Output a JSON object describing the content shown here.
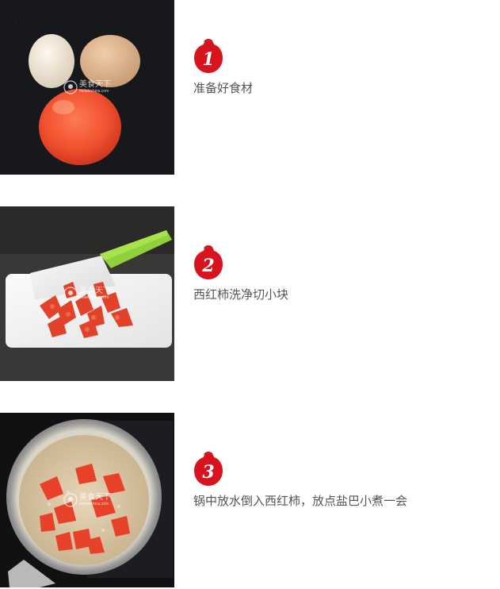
{
  "watermark": {
    "text": "美食天下",
    "sub": "meishichina.com",
    "icon": "chef-logo-icon"
  },
  "steps": [
    {
      "number": "1",
      "text": "准备好食材",
      "photo": "eggs-and-tomato-photo"
    },
    {
      "number": "2",
      "text": "西红柿洗净切小块",
      "photo": "chopped-tomato-photo"
    },
    {
      "number": "3",
      "text": "锅中放水倒入西红柿，放点盐巴小煮一会",
      "photo": "tomato-boiling-pot-photo"
    }
  ],
  "colors": {
    "badge_red": "#d7141e",
    "text": "#555555"
  }
}
